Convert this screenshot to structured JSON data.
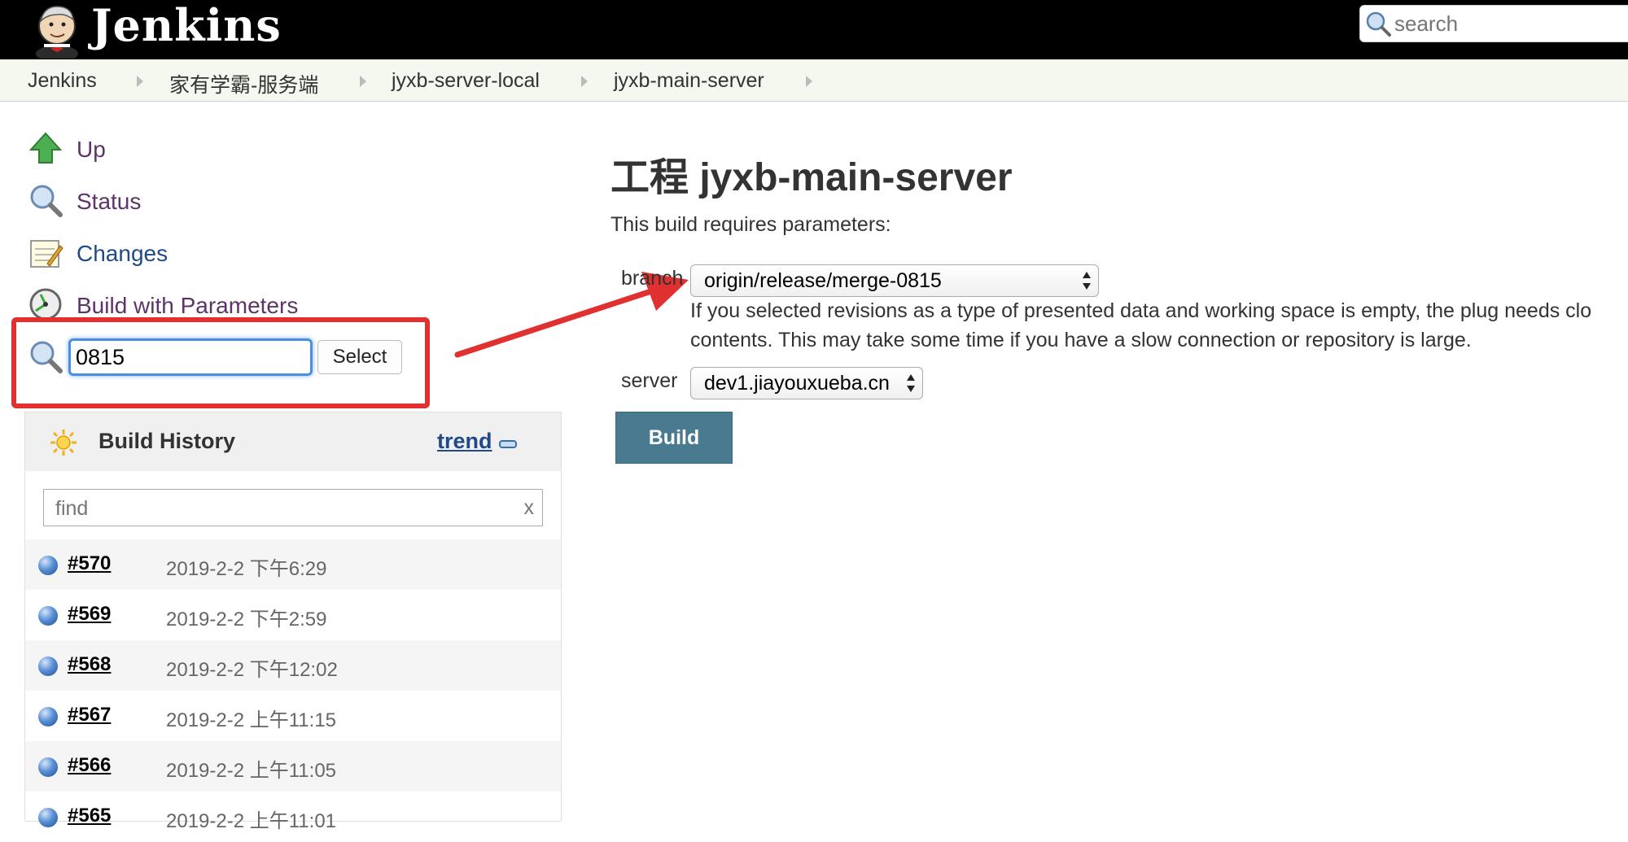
{
  "header": {
    "brand": "Jenkins",
    "search_placeholder": "search"
  },
  "breadcrumb": {
    "items": [
      "Jenkins",
      "家有学霸-服务端",
      "jyxb-server-local",
      "jyxb-main-server"
    ]
  },
  "sidebar": {
    "tasks": [
      {
        "label": "Up",
        "icon": "up-arrow-icon"
      },
      {
        "label": "Status",
        "icon": "magnifier-icon"
      },
      {
        "label": "Changes",
        "icon": "notepad-icon"
      },
      {
        "label": "Build with Parameters",
        "icon": "clock-icon"
      }
    ],
    "select_value": "0815",
    "select_button": "Select"
  },
  "build_history": {
    "title": "Build History",
    "trend_label": "trend",
    "find_placeholder": "find",
    "find_clear": "x",
    "builds": [
      {
        "number": "#570",
        "date": "2019-2-2 下午6:29"
      },
      {
        "number": "#569",
        "date": "2019-2-2 下午2:59"
      },
      {
        "number": "#568",
        "date": "2019-2-2 下午12:02"
      },
      {
        "number": "#567",
        "date": "2019-2-2 上午11:15"
      },
      {
        "number": "#566",
        "date": "2019-2-2 上午11:05"
      },
      {
        "number": "#565",
        "date": "2019-2-2 上午11:01"
      }
    ]
  },
  "main": {
    "title": "工程 jyxb-main-server",
    "description": "This build requires parameters:",
    "params": {
      "branch_label": "branch",
      "branch_value": "origin/release/merge-0815",
      "branch_help_line1": "If you selected revisions as a type of presented data and working space is empty, the plug needs clo",
      "branch_help_line2": "contents. This may take some time if you have a slow connection or repository is large.",
      "server_label": "server",
      "server_value": "dev1.jiayouxueba.cn"
    },
    "build_button": "Build"
  },
  "colors": {
    "header_bg": "#000000",
    "breadcrumb_bg": "#f4f8ee",
    "highlight_red": "#e03030",
    "build_button_bg": "#4a7a90"
  }
}
